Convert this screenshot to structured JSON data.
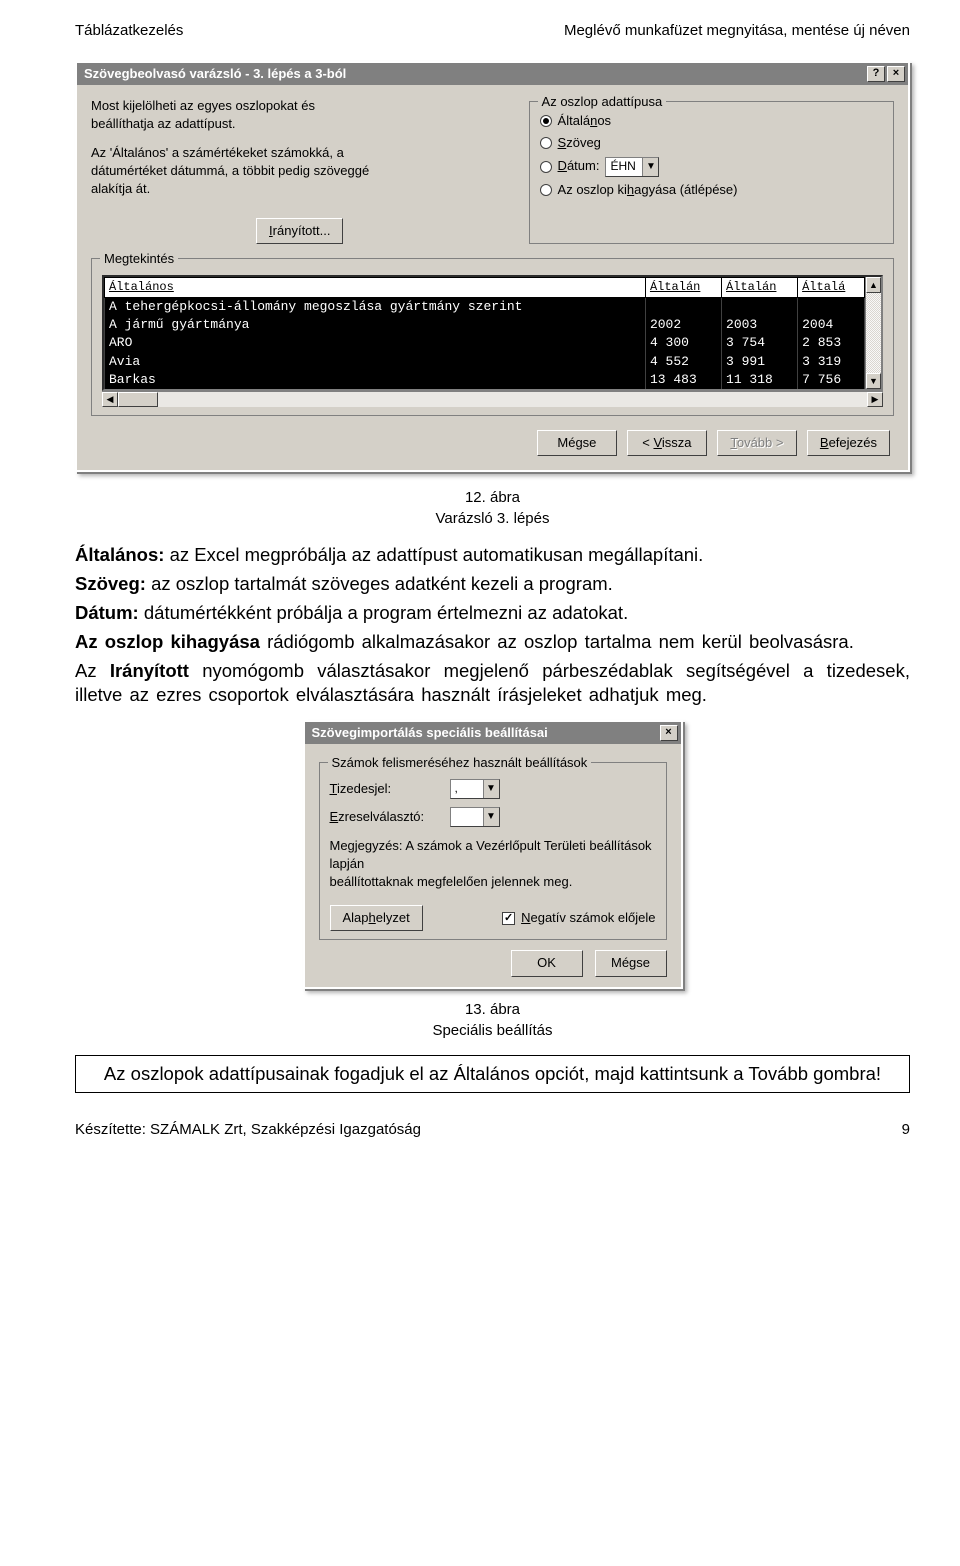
{
  "header": {
    "left": "Táblázatkezelés",
    "right": "Meglévő munkafüzet megnyitása, mentése új néven"
  },
  "dialog1": {
    "title": "Szövegbeolvasó varázsló - 3. lépés a 3-ból",
    "help_btn": "?",
    "close_btn": "×",
    "intro_line1": "Most kijelölheti az egyes oszlopokat és",
    "intro_line2": "beállíthatja az adattípust.",
    "desc_line1": "Az 'Általános' a számértékeket számokká, a",
    "desc_line2": "dátumértéket dátummá, a többit pedig szöveggé",
    "desc_line3": "alakítja át.",
    "advanced_btn": "Irányított...",
    "col_type_legend": "Az oszlop adattípusa",
    "radios": {
      "general": "Általános",
      "text": "Szöveg",
      "date": "Dátum:",
      "skip": "Az oszlop kihagyása (átlépése)"
    },
    "date_dropdown": "ÉHN",
    "preview_legend": "Megtekintés",
    "preview_headers": [
      "Általános",
      "Általán",
      "Általán",
      "Általá"
    ],
    "preview_rows": [
      [
        "A tehergépkocsi-állomány megoszlása gyártmány szerint",
        "",
        "",
        ""
      ],
      [
        "A jármű gyártmánya",
        "2002",
        "2003",
        "2004"
      ],
      [
        "ARO",
        "4 300",
        "3 754",
        "2 853"
      ],
      [
        "Avia",
        "4 552",
        "3 991",
        "3 319"
      ],
      [
        "Barkas",
        "13 483",
        "11 318",
        "7 756"
      ]
    ],
    "buttons": {
      "cancel": "Mégse",
      "back": "< Vissza",
      "next": "Tovább >",
      "finish": "Befejezés"
    }
  },
  "caption1_line1": "12. ábra",
  "caption1_line2": "Varázsló 3. lépés",
  "paras": {
    "p1": "Általános: az Excel megpróbálja az adattípust automatikusan megállapítani.",
    "p2": "Szöveg: az oszlop tartalmát szöveges adatként kezeli a program.",
    "p3": "Dátum: dátumértékként próbálja a program értelmezni az adatokat.",
    "p4": "Az oszlop kihagyása rádiógomb alkalmazásakor az oszlop tartalma nem kerül beolvasásra.",
    "p5": "Az Irányított nyomógomb választásakor megjelenő párbeszédablak segítségével a tizedesek, illetve az ezres csoportok elválasztására használt írásjeleket adhatjuk meg."
  },
  "dialog2": {
    "title": "Szövegimportálás speciális beállításai",
    "close_btn": "×",
    "group_legend": "Számok felismeréséhez használt beállítások",
    "decimal_label": "Tizedesjel:",
    "decimal_value": ",",
    "thousands_label": "Ezreselválasztó:",
    "thousands_value": "",
    "note_line1": "Megjegyzés: A számok a Vezérlőpult Területi beállítások lapján",
    "note_line2": "beállítottaknak megfelelően jelennek meg.",
    "reset_btn": "Alaphelyzet",
    "neg_checkbox_label": "Negatív számok előjele",
    "ok_btn": "OK",
    "cancel_btn": "Mégse"
  },
  "caption2_line1": "13. ábra",
  "caption2_line2": "Speciális beállítás",
  "boxed": "Az oszlopok adattípusainak fogadjuk el az Általános opciót, majd kattintsunk a Tovább gombra!",
  "footer": {
    "left": "Készítette: SZÁMALK Zrt, Szakképzési Igazgatóság",
    "right": "9"
  }
}
